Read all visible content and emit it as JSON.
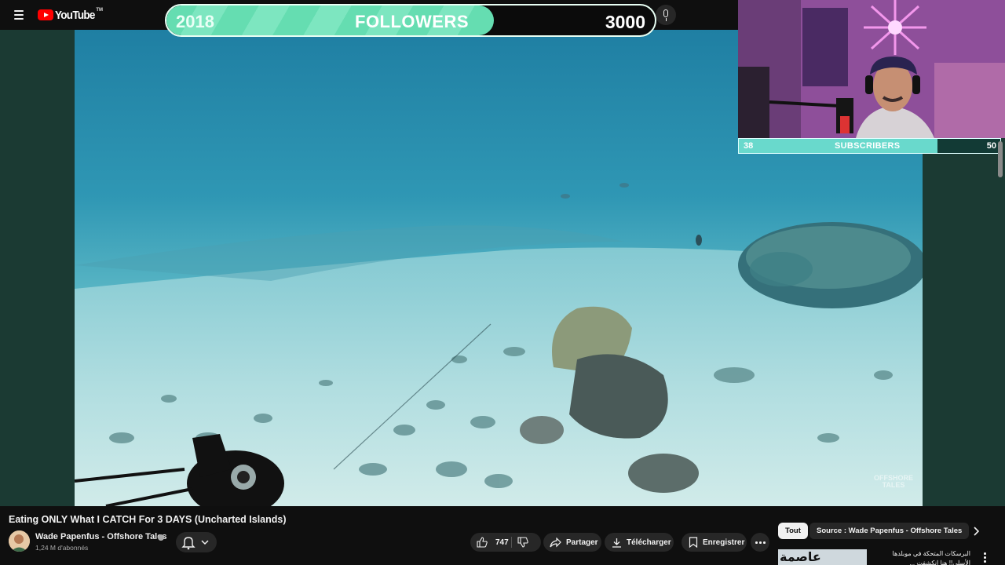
{
  "header": {
    "logo_text": "YouTube",
    "logo_tm": "TM",
    "menu_icon": "hamburger-menu-icon",
    "mic_icon": "microphone-icon"
  },
  "followers_goal": {
    "start": "2018",
    "label": "FOLLOWERS",
    "goal": "3000",
    "progress_fraction": 0.67,
    "fill_color": "#65ddb1"
  },
  "subscribers_goal": {
    "start": "38",
    "label": "SUBSCRIBERS",
    "goal": "50",
    "progress_fraction": 0.76,
    "fill_color": "#69d9cc"
  },
  "player": {
    "watermark": "OFFSHORE\nTALES"
  },
  "video": {
    "title": "Eating ONLY What I CATCH For 3 DAYS (Uncharted Islands)",
    "channel_name": "Wade Papenfus - Offshore Tales",
    "subscribers": "1,24 M d'abonnés",
    "likes": "747",
    "share_label": "Partager",
    "download_label": "Télécharger",
    "save_label": "Enregistrer"
  },
  "sidebar": {
    "chips": [
      "Tout",
      "Source : Wade Papenfus - Offshore Tales"
    ],
    "recommendation": {
      "thumb_text": "عاصمة",
      "title": "البرسكات المتحكة في موبلدها الأسلي!! هنا انكشفت ..."
    }
  }
}
